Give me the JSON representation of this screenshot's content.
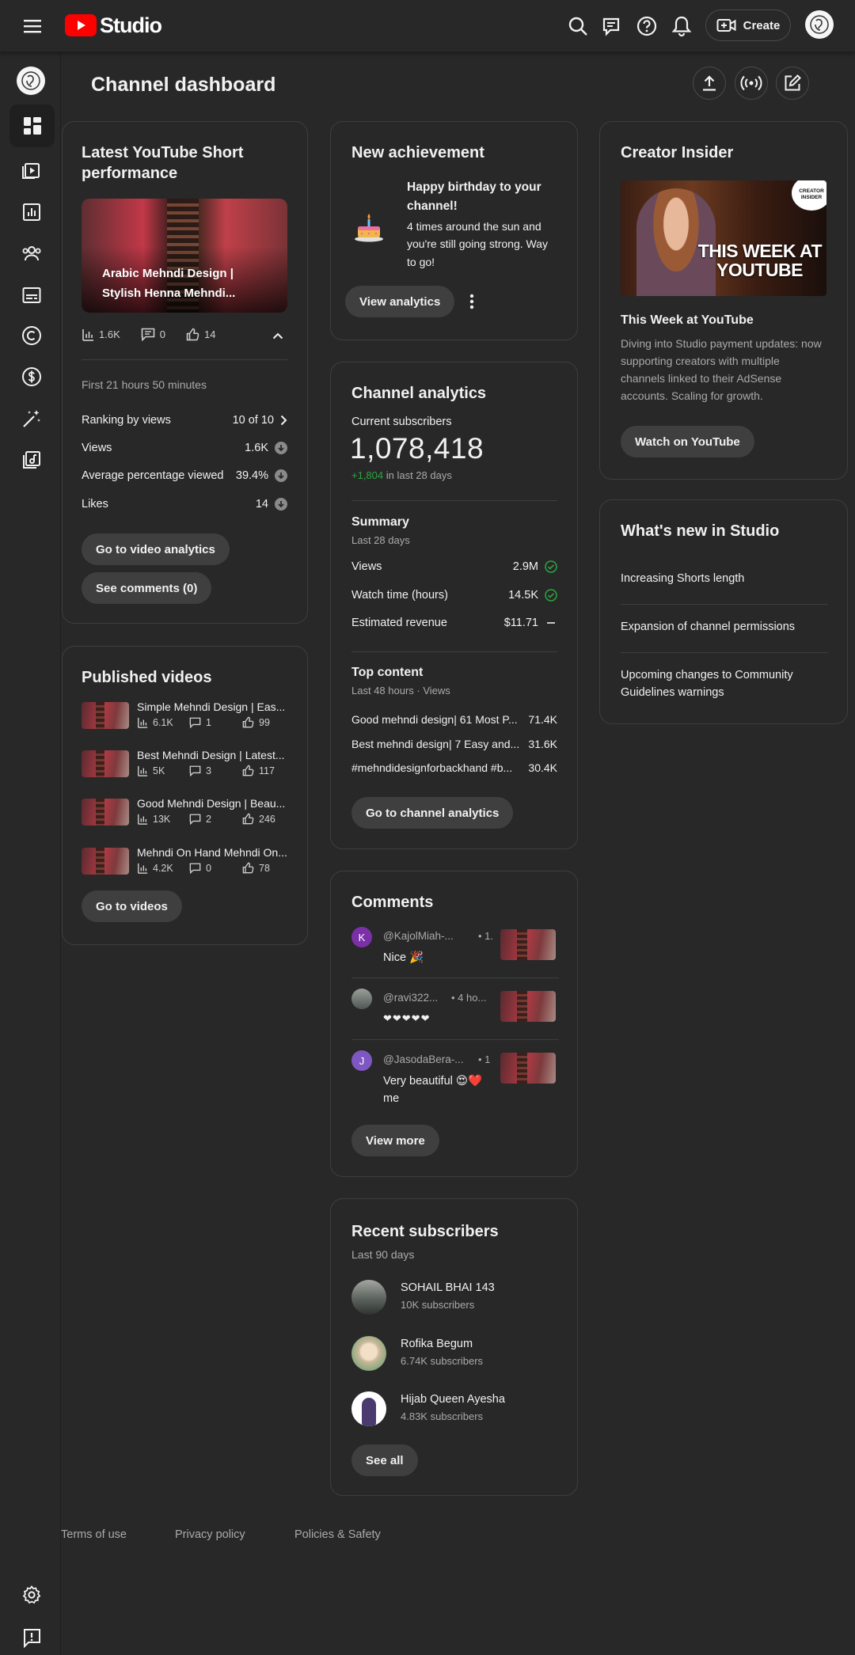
{
  "header": {
    "logo_text": "Studio",
    "create_label": "Create",
    "brand_color": "#ff0000"
  },
  "page": {
    "title": "Channel dashboard"
  },
  "short_card": {
    "title_line1": "Latest YouTube Short",
    "title_line2": "performance",
    "video_title_line1": "Arabic Mehndi Design |",
    "video_title_line2": "Stylish Henna Mehndi...",
    "views": "1.6K",
    "comments": "0",
    "likes": "14",
    "period": "First 21 hours 50 minutes",
    "rows": [
      {
        "label": "Ranking by views",
        "value": "10 of 10"
      },
      {
        "label": "Views",
        "value": "1.6K"
      },
      {
        "label": "Average percentage viewed",
        "value": "39.4%"
      },
      {
        "label": "Likes",
        "value": "14"
      }
    ],
    "btn_analytics": "Go to video analytics",
    "btn_comments": "See comments (0)"
  },
  "published": {
    "title": "Published videos",
    "videos": [
      {
        "title": "Simple Mehndi Design | Eas...",
        "views": "6.1K",
        "comments": "1",
        "likes": "99"
      },
      {
        "title": "Best Mehndi Design | Latest...",
        "views": "5K",
        "comments": "3",
        "likes": "117"
      },
      {
        "title": "Good Mehndi Design | Beau...",
        "views": "13K",
        "comments": "2",
        "likes": "246"
      },
      {
        "title": "Mehndi On Hand Mehndi On...",
        "views": "4.2K",
        "comments": "0",
        "likes": "78"
      }
    ],
    "btn": "Go to videos"
  },
  "achievement": {
    "title": "New achievement",
    "headline_line1": "Happy birthday to your",
    "headline_line2": "channel!",
    "body_line1": "4 times around the sun and",
    "body_line2": "you're still going strong. Way",
    "body_line3": "to go!",
    "btn": "View analytics"
  },
  "analytics": {
    "title": "Channel analytics",
    "subs_label": "Current subscribers",
    "subs_value": "1,078,418",
    "subs_delta": "+1,804",
    "subs_delta_suffix": " in last 28 days",
    "summary_title": "Summary",
    "summary_period": "Last 28 days",
    "summary_rows": [
      {
        "label": "Views",
        "value": "2.9M"
      },
      {
        "label": "Watch time (hours)",
        "value": "14.5K"
      },
      {
        "label": "Estimated revenue",
        "value": "$11.71"
      }
    ],
    "top_title": "Top content",
    "top_period": "Last 48 hours · Views",
    "top_rows": [
      {
        "label": "Good mehndi design| 61 Most P...",
        "value": "71.4K"
      },
      {
        "label": "Best mehndi design| 7 Easy and...",
        "value": "31.6K"
      },
      {
        "label": "#mehndidesignforbackhand #b...",
        "value": "30.4K"
      }
    ],
    "btn": "Go to channel analytics",
    "delta_color": "#2ba640"
  },
  "comments": {
    "title": "Comments",
    "items": [
      {
        "initial": "K",
        "user": "@KajolMiah-...",
        "time": "• 1.",
        "text_line1": "Nice 🎉",
        "text_line2": ""
      },
      {
        "initial": "",
        "user": "@ravi322...",
        "time": "• 4 ho...",
        "text_line1": "❤❤❤❤❤",
        "text_line2": ""
      },
      {
        "initial": "J",
        "user": "@JasodaBera-...",
        "time": "• 1",
        "text_line1": "Very beautiful 😍❤️",
        "text_line2": "me"
      }
    ],
    "btn": "View more"
  },
  "subscribers": {
    "title": "Recent subscribers",
    "period": "Last 90 days",
    "items": [
      {
        "name": "SOHAIL BHAI 143",
        "count": "10K subscribers"
      },
      {
        "name": "Rofika Begum",
        "count": "6.74K subscribers"
      },
      {
        "name": "Hijab Queen Ayesha",
        "count": "4.83K subscribers"
      }
    ],
    "btn": "See all"
  },
  "insider": {
    "title": "Creator Insider",
    "thumb_line1": "THIS WEEK AT",
    "thumb_line2": "YOUTUBE",
    "badge_line1": "CREATOR",
    "badge_line2": "INSIDER",
    "video_title": "This Week at YouTube",
    "desc_line1": "Diving into Studio payment updates: now",
    "desc_line2": "supporting creators with multiple",
    "desc_line3": "channels linked to their AdSense",
    "desc_line4": "accounts. Scaling for growth.",
    "btn": "Watch on YouTube"
  },
  "whatsnew": {
    "title": "What's new in Studio",
    "items": [
      {
        "line1": "Increasing Shorts length",
        "line2": ""
      },
      {
        "line1": "Expansion of channel permissions",
        "line2": ""
      },
      {
        "line1": "Upcoming changes to Community",
        "line2": "Guidelines warnings"
      }
    ]
  },
  "footer": {
    "links": [
      "Terms of use",
      "Privacy policy",
      "Policies & Safety"
    ]
  }
}
